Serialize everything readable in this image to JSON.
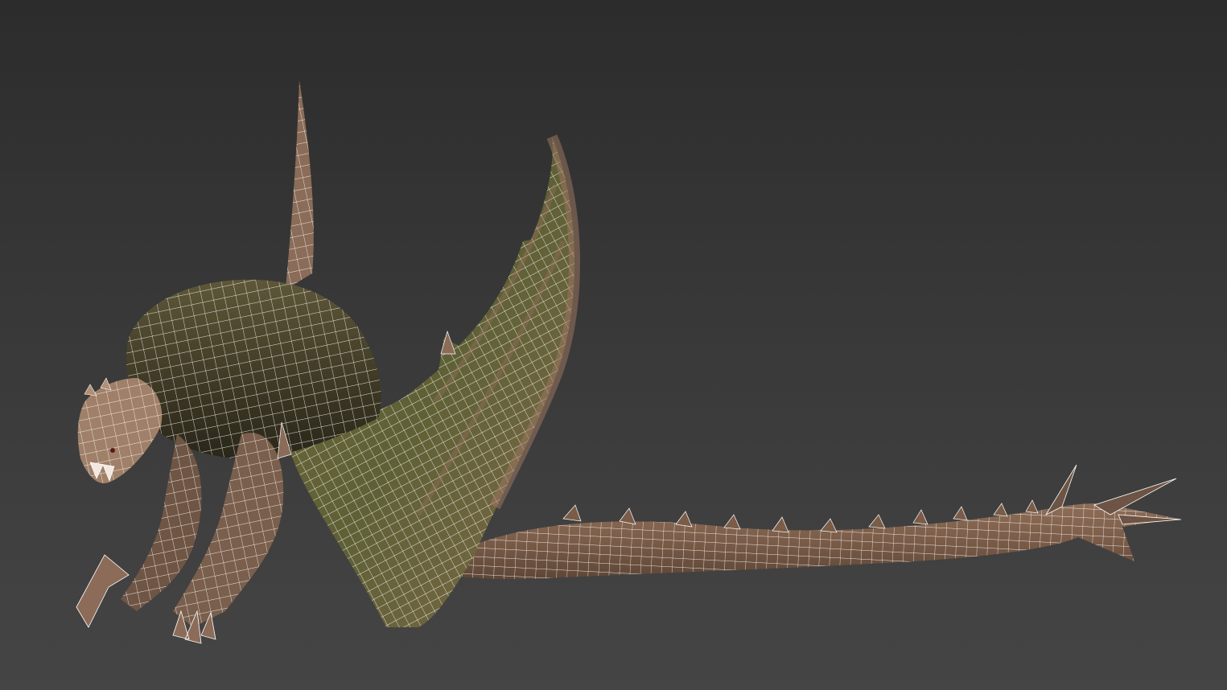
{
  "viewport": {
    "background_top": "#2c2c2c",
    "background_bottom": "#454545",
    "wire_color": "#ffffff",
    "model_name": "",
    "model_colors": {
      "wing_membrane": "#6b6a3e",
      "wing_bone": "#8a6a55",
      "body_back": "#5d5738",
      "body_dark": "#2f2b1d",
      "skin": "#8c6c58",
      "tail": "#8b6a55",
      "head": "#a08068"
    }
  }
}
